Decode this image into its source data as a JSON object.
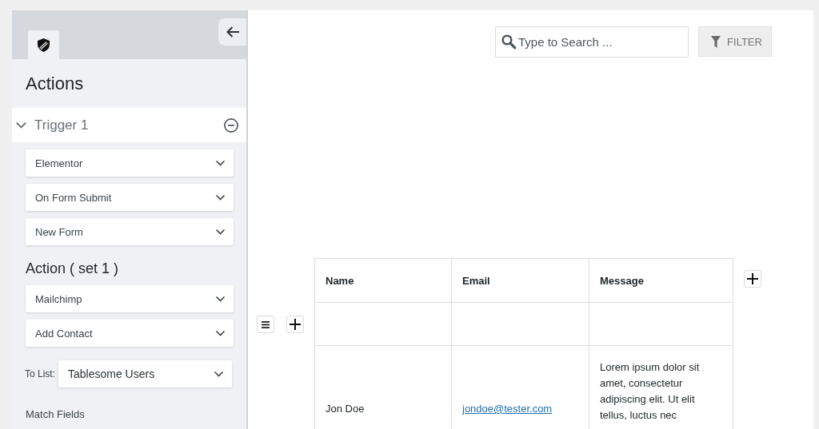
{
  "sidebar": {
    "title": "Actions",
    "trigger": {
      "label": "Trigger 1",
      "expanded": true,
      "selects": [
        "Elementor",
        "On Form Submit",
        "New Form"
      ]
    },
    "action": {
      "heading": "Action ( set 1 )",
      "selects": [
        "Mailchimp",
        "Add Contact"
      ],
      "list_field": {
        "label": "To List:",
        "value": "Tablesome Users"
      }
    },
    "match_fields": "Match Fields"
  },
  "toolbar": {
    "search": {
      "placeholder": "Type to Search ..."
    },
    "filter_button": "FILTER"
  },
  "table": {
    "columns": [
      "Name",
      "Email",
      "Message"
    ],
    "rows": [
      {
        "kind": "blank"
      },
      {
        "kind": "data",
        "cells": [
          {
            "kind": "text",
            "text": "Jon Doe"
          },
          {
            "kind": "link",
            "text": "jondoe@tester.com"
          },
          {
            "kind": "text",
            "text": "Lorem ipsum dolor sit amet, consectetur adipiscing elit. Ut elit tellus, luctus nec"
          }
        ]
      }
    ]
  }
}
